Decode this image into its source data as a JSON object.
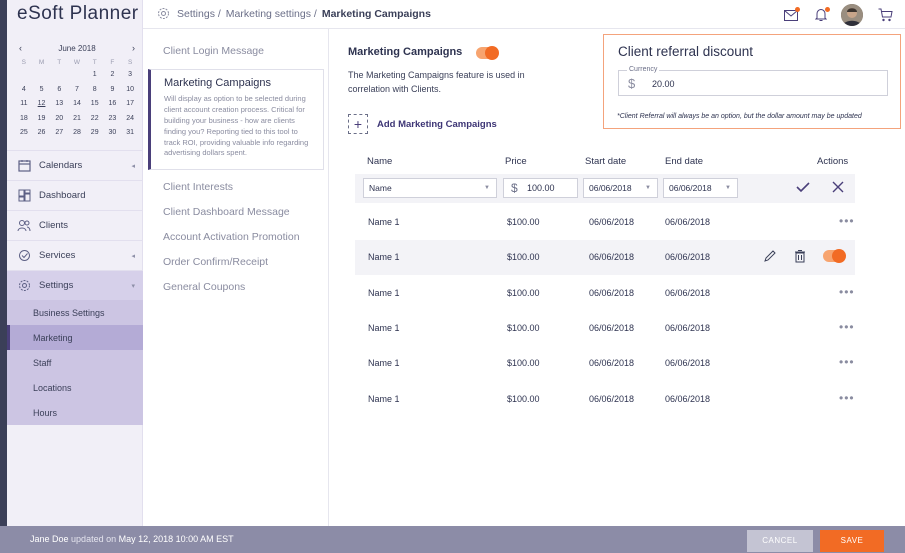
{
  "app": {
    "brand": "eSoft Planner"
  },
  "calendar": {
    "month": "June 2018",
    "prev_icon": "‹",
    "next_icon": "›",
    "weekdays": [
      "S",
      "M",
      "T",
      "W",
      "T",
      "F",
      "S"
    ],
    "weeks": [
      [
        "",
        "",
        "",
        "",
        "1",
        "2",
        "3"
      ],
      [
        "4",
        "5",
        "6",
        "7",
        "8",
        "9",
        "10"
      ],
      [
        "11",
        "12",
        "13",
        "14",
        "15",
        "16",
        "17"
      ],
      [
        "18",
        "19",
        "20",
        "21",
        "22",
        "23",
        "24"
      ],
      [
        "25",
        "26",
        "27",
        "28",
        "29",
        "30",
        "31"
      ]
    ],
    "today": "12"
  },
  "sidebar": {
    "items": [
      {
        "label": "Calendars",
        "icon": "calendar-icon",
        "caret": "◂"
      },
      {
        "label": "Dashboard",
        "icon": "dashboard-icon"
      },
      {
        "label": "Clients",
        "icon": "users-icon"
      },
      {
        "label": "Services",
        "icon": "services-icon",
        "caret": "◂"
      },
      {
        "label": "Settings",
        "icon": "gear-icon",
        "caret": "▾"
      }
    ],
    "sub_items": [
      "Business Settings",
      "Marketing",
      "Staff",
      "Locations",
      "Hours"
    ],
    "active_sub": "Marketing"
  },
  "breadcrumb": {
    "part1": "Settings /",
    "part2": "Marketing settings /",
    "current": "Marketing Campaigns"
  },
  "topbar": {
    "icons": [
      "mail-icon",
      "bell-icon",
      "avatar",
      "cart-icon"
    ]
  },
  "settings_menu": {
    "first": "Client Login Message",
    "card": {
      "title": "Marketing Campaigns",
      "description": "Will display as option to be selected during client account creation process. Critical for building your business - how are clients finding you? Reporting tied to this tool to track ROI, providing valuable info regarding advertising dollars spent."
    },
    "rest": [
      "Client Interests",
      "Client Dashboard Message",
      "Account Activation Promotion",
      "Order Confirm/Receipt",
      "General Coupons"
    ]
  },
  "main": {
    "title": "Marketing Campaigns",
    "description": "The Marketing Campaigns feature is used in correlation with Clients.",
    "add_label": "Add Marketing Campaigns"
  },
  "referral": {
    "title": "Client referral discount",
    "field_label": "Currency",
    "currency_symbol": "$",
    "value": "20.00",
    "note": "*Client Referral will always be an option, but the dollar amount may be updated"
  },
  "table": {
    "headers": {
      "name": "Name",
      "price": "Price",
      "start": "Start date",
      "end": "End date",
      "actions": "Actions"
    },
    "edit_row": {
      "name": "Name",
      "currency": "$",
      "price": "100.00",
      "start": "06/06/2018",
      "end": "06/06/2018"
    },
    "rows": [
      {
        "name": "Name 1",
        "price": "$100.00",
        "start": "06/06/2018",
        "end": "06/06/2018"
      },
      {
        "name": "Name 1",
        "price": "$100.00",
        "start": "06/06/2018",
        "end": "06/06/2018"
      },
      {
        "name": "Name 1",
        "price": "$100.00",
        "start": "06/06/2018",
        "end": "06/06/2018"
      },
      {
        "name": "Name 1",
        "price": "$100.00",
        "start": "06/06/2018",
        "end": "06/06/2018"
      },
      {
        "name": "Name 1",
        "price": "$100.00",
        "start": "06/06/2018",
        "end": "06/06/2018"
      },
      {
        "name": "Name 1",
        "price": "$100.00",
        "start": "06/06/2018",
        "end": "06/06/2018"
      }
    ],
    "more_glyph": "•••"
  },
  "footer": {
    "user": "Jane Doe",
    "text": "updated on",
    "date": "May 12, 2018 10:00 AM EST",
    "cancel": "CANCEL",
    "save": "SAVE"
  },
  "colors": {
    "accent": "#f26b24",
    "primary": "#4a3f7a",
    "sidebar": "#f1eff7"
  }
}
